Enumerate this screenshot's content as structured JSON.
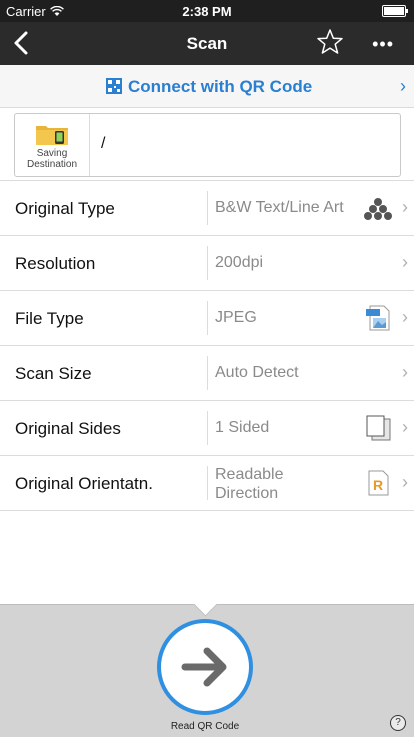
{
  "statusbar": {
    "carrier": "Carrier",
    "time": "2:38 PM"
  },
  "navbar": {
    "title": "Scan",
    "more": "•••"
  },
  "qr": {
    "label": "Connect with QR Code"
  },
  "destination": {
    "label": "Saving Destination",
    "path": "/"
  },
  "settings": [
    {
      "label": "Original Type",
      "value": "B&W Text/Line Art",
      "icon": "dots-icon"
    },
    {
      "label": "Resolution",
      "value": "200dpi",
      "icon": ""
    },
    {
      "label": "File Type",
      "value": "JPEG",
      "icon": "jpeg-file-icon"
    },
    {
      "label": "Scan Size",
      "value": "Auto Detect",
      "icon": ""
    },
    {
      "label": "Original Sides",
      "value": "1 Sided",
      "icon": "one-sided-icon"
    },
    {
      "label": "Original Orientatn.",
      "value": "Readable Direction",
      "icon": "orientation-icon"
    }
  ],
  "bottom": {
    "read_label": "Read QR Code",
    "help": "?"
  },
  "colors": {
    "accent": "#2a7fd0",
    "navbar": "#2b2b2b",
    "button_ring": "#2f8fe0"
  }
}
